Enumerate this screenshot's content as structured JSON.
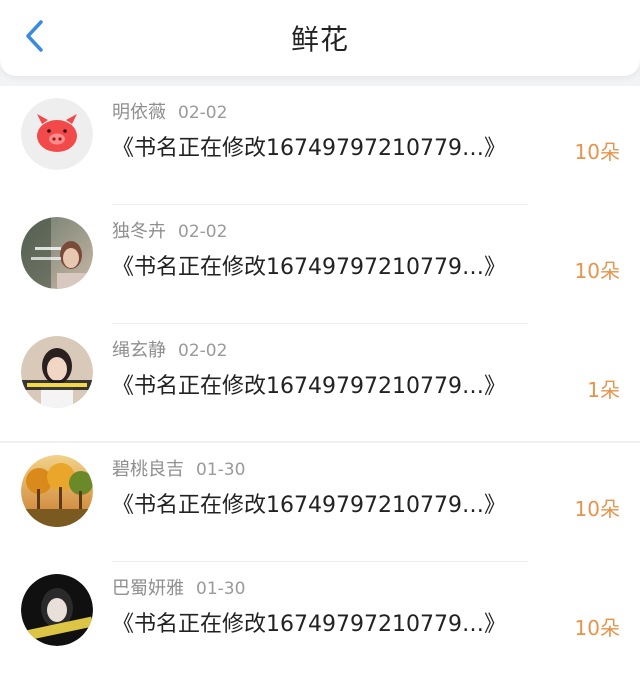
{
  "header": {
    "title": "鲜花",
    "back_icon": "chevron-left-icon"
  },
  "colors": {
    "accent_back": "#3a8be0",
    "count": "#e8934a"
  },
  "items": [
    {
      "name": "明依薇",
      "date": "02-02",
      "book": "《书名正在修改16749797210779…》",
      "count": "10朵",
      "avatar": "pig-avatar"
    },
    {
      "name": "独冬卉",
      "date": "02-02",
      "book": "《书名正在修改16749797210779…》",
      "count": "10朵",
      "avatar": "portrait-avatar"
    },
    {
      "name": "绳玄静",
      "date": "02-02",
      "book": "《书名正在修改16749797210779…》",
      "count": "1朵",
      "avatar": "portrait-avatar"
    },
    {
      "name": "碧桃良吉",
      "date": "01-30",
      "book": "《书名正在修改16749797210779…》",
      "count": "10朵",
      "avatar": "landscape-avatar"
    },
    {
      "name": "巴蜀妍雅",
      "date": "01-30",
      "book": "《书名正在修改16749797210779…》",
      "count": "10朵",
      "avatar": "portrait-avatar"
    }
  ]
}
